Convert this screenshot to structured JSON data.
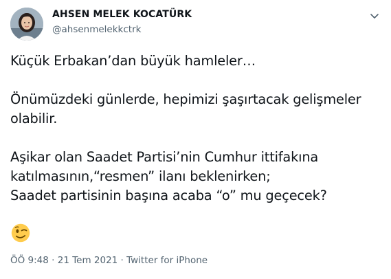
{
  "author": {
    "display_name": "AHSEN MELEK KOCATÜRK",
    "handle": "@ahsenmelekkctrk",
    "avatar_icon": "profile-photo"
  },
  "menu_icon": "chevron-down-icon",
  "tweet": {
    "lines": [
      "Küçük Erbakan’dan büyük hamleler…",
      "Önümüzdeki günlerde, hepimizi şaşırtacak gelişmeler",
      "olabilir.",
      "Aşikar olan Saadet Partisi’nin Cumhur ittifakına",
      "katılmasının,“resmen” ilanı beklenirken;",
      "Saadet partisinin başına acaba “o” mu geçecek?"
    ],
    "emoji": "winking-face-emoji"
  },
  "meta": {
    "timestamp": "ÖÖ 9:48 · 21 Tem 2021 · Twitter for iPhone"
  },
  "colors": {
    "text_primary": "#0f1419",
    "text_secondary": "#536471",
    "emoji_yellow": "#ffcc4d"
  }
}
